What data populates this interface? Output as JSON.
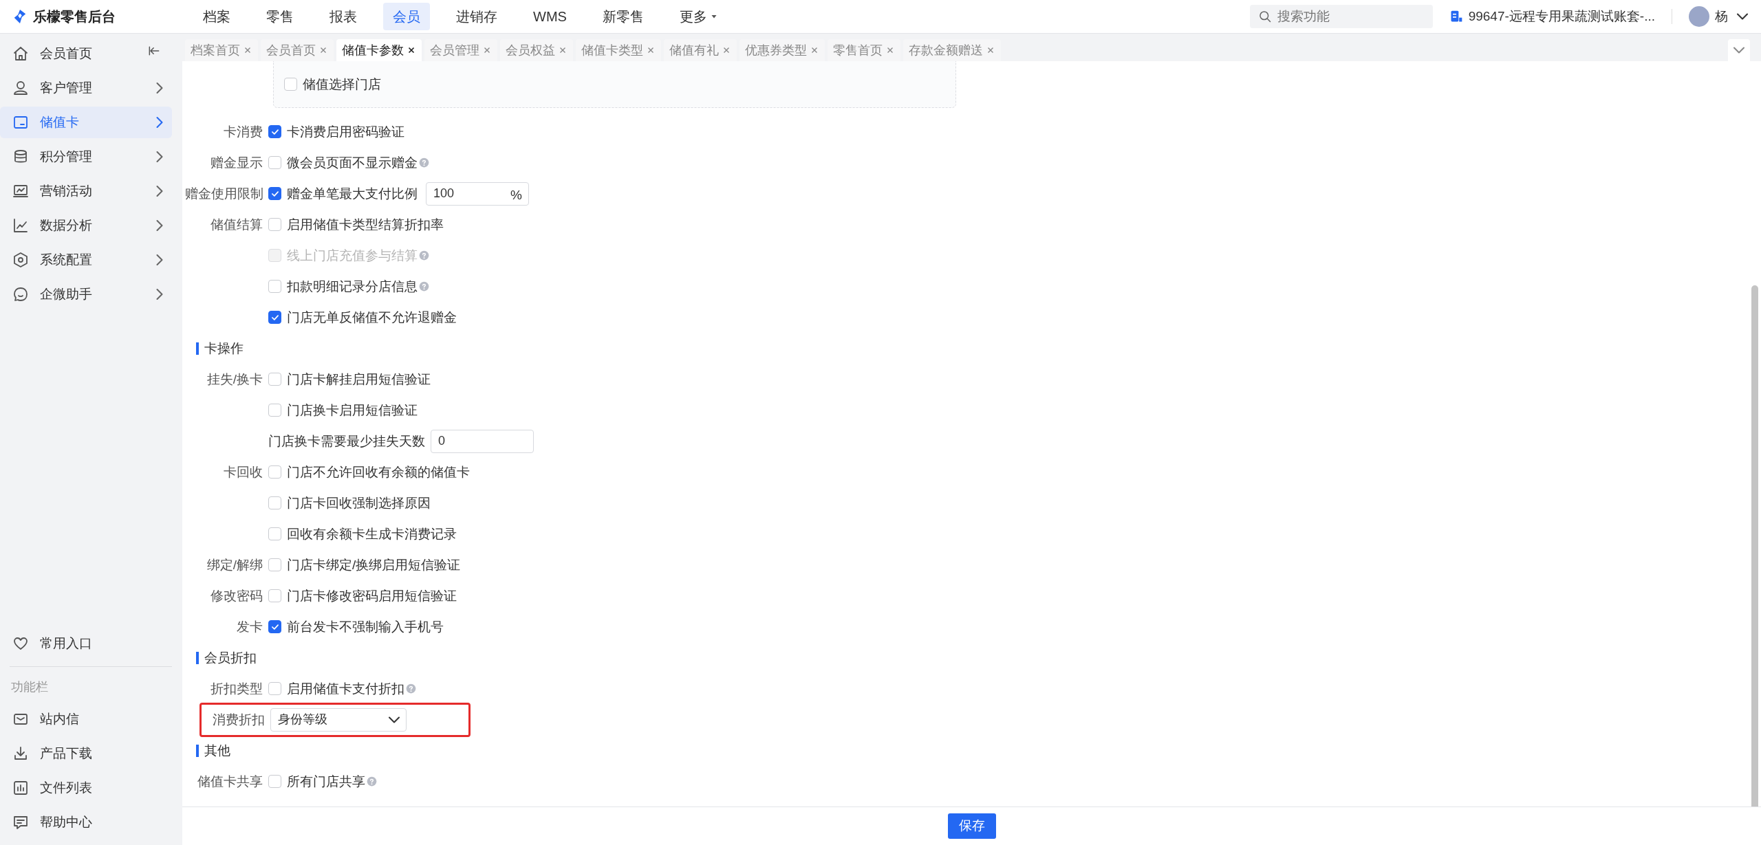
{
  "app": {
    "title": "乐檬零售后台"
  },
  "top_nav": [
    {
      "label": "档案",
      "selected": false,
      "has_menu": false
    },
    {
      "label": "零售",
      "selected": false,
      "has_menu": false
    },
    {
      "label": "报表",
      "selected": false,
      "has_menu": false
    },
    {
      "label": "会员",
      "selected": true,
      "has_menu": false
    },
    {
      "label": "进销存",
      "selected": false,
      "has_menu": false
    },
    {
      "label": "WMS",
      "selected": false,
      "has_menu": false
    },
    {
      "label": "新零售",
      "selected": false,
      "has_menu": false
    },
    {
      "label": "更多",
      "selected": false,
      "has_menu": true
    }
  ],
  "search": {
    "placeholder": "搜索功能"
  },
  "account": {
    "text": "99647-远程专用果蔬测试账套-..."
  },
  "user": {
    "name": "杨"
  },
  "sidebar": {
    "items": [
      {
        "label": "会员首页",
        "selected": false,
        "has_arrow": false
      },
      {
        "label": "客户管理",
        "selected": false,
        "has_arrow": true
      },
      {
        "label": "储值卡",
        "selected": true,
        "has_arrow": true
      },
      {
        "label": "积分管理",
        "selected": false,
        "has_arrow": true
      },
      {
        "label": "营销活动",
        "selected": false,
        "has_arrow": true
      },
      {
        "label": "数据分析",
        "selected": false,
        "has_arrow": true
      },
      {
        "label": "系统配置",
        "selected": false,
        "has_arrow": true
      },
      {
        "label": "企微助手",
        "selected": false,
        "has_arrow": true
      }
    ],
    "favorites": "常用入口",
    "section_title": "功能栏",
    "tools": [
      "站内信",
      "产品下载",
      "文件列表",
      "帮助中心"
    ]
  },
  "tabs": [
    {
      "label": "档案首页",
      "selected": false
    },
    {
      "label": "会员首页",
      "selected": false
    },
    {
      "label": "储值卡参数",
      "selected": true
    },
    {
      "label": "会员管理",
      "selected": false
    },
    {
      "label": "会员权益",
      "selected": false
    },
    {
      "label": "储值卡类型",
      "selected": false
    },
    {
      "label": "储值有礼",
      "selected": false
    },
    {
      "label": "优惠券类型",
      "selected": false
    },
    {
      "label": "零售首页",
      "selected": false
    },
    {
      "label": "存款金额赠送",
      "selected": false
    }
  ],
  "store_box": {
    "text": "储值选择门店",
    "checked": false
  },
  "form_rows": [
    {
      "kind": "checkbox",
      "label": "卡消费",
      "text": "卡消费启用密码验证",
      "checked": true,
      "disabled": false,
      "help": false
    },
    {
      "kind": "checkbox",
      "label": "赠金显示",
      "text": "微会员页面不显示赠金",
      "checked": false,
      "disabled": false,
      "help": true
    },
    {
      "kind": "checkbox",
      "label": "赠金使用限制",
      "text": "赠金单笔最大支付比例",
      "checked": true,
      "disabled": false,
      "help": false,
      "value": "100",
      "unit": "%"
    },
    {
      "kind": "checkbox",
      "label": "储值结算",
      "text": "启用储值卡类型结算折扣率",
      "checked": false,
      "disabled": false,
      "help": false
    },
    {
      "kind": "checkbox",
      "text": "线上门店充值参与结算",
      "checked": false,
      "disabled": true,
      "help": true
    },
    {
      "kind": "checkbox",
      "text": "扣款明细记录分店信息",
      "checked": false,
      "disabled": false,
      "help": true
    },
    {
      "kind": "checkbox",
      "text": "门店无单反储值不允许退赠金",
      "checked": true,
      "disabled": false,
      "help": false
    },
    {
      "kind": "section",
      "text": "卡操作"
    },
    {
      "kind": "checkbox",
      "label": "挂失/换卡",
      "text": "门店卡解挂启用短信验证",
      "checked": false,
      "disabled": false,
      "help": false
    },
    {
      "kind": "checkbox",
      "text": "门店换卡启用短信验证",
      "checked": false,
      "disabled": false,
      "help": false
    },
    {
      "kind": "input",
      "text": "门店换卡需要最少挂失天数",
      "value": "0"
    },
    {
      "kind": "checkbox",
      "label": "卡回收",
      "text": "门店不允许回收有余额的储值卡",
      "checked": false,
      "disabled": false,
      "help": false
    },
    {
      "kind": "checkbox",
      "text": "门店卡回收强制选择原因",
      "checked": false,
      "disabled": false,
      "help": false
    },
    {
      "kind": "checkbox",
      "text": "回收有余额卡生成卡消费记录",
      "checked": false,
      "disabled": false,
      "help": false
    },
    {
      "kind": "checkbox",
      "label": "绑定/解绑",
      "text": "门店卡绑定/换绑启用短信验证",
      "checked": false,
      "disabled": false,
      "help": false
    },
    {
      "kind": "checkbox",
      "label": "修改密码",
      "text": "门店卡修改密码启用短信验证",
      "checked": false,
      "disabled": false,
      "help": false
    },
    {
      "kind": "checkbox",
      "label": "发卡",
      "text": "前台发卡不强制输入手机号",
      "checked": true,
      "disabled": false,
      "help": false
    },
    {
      "kind": "section",
      "text": "会员折扣"
    },
    {
      "kind": "checkbox",
      "label": "折扣类型",
      "text": "启用储值卡支付折扣",
      "checked": false,
      "disabled": false,
      "help": true
    },
    {
      "kind": "select",
      "label": "消费折扣",
      "value": "身份等级",
      "highlighted": true
    },
    {
      "kind": "section",
      "text": "其他"
    },
    {
      "kind": "checkbox",
      "label": "储值卡共享",
      "text": "所有门店共享",
      "checked": false,
      "disabled": false,
      "help": true
    }
  ],
  "save_button": "保存"
}
